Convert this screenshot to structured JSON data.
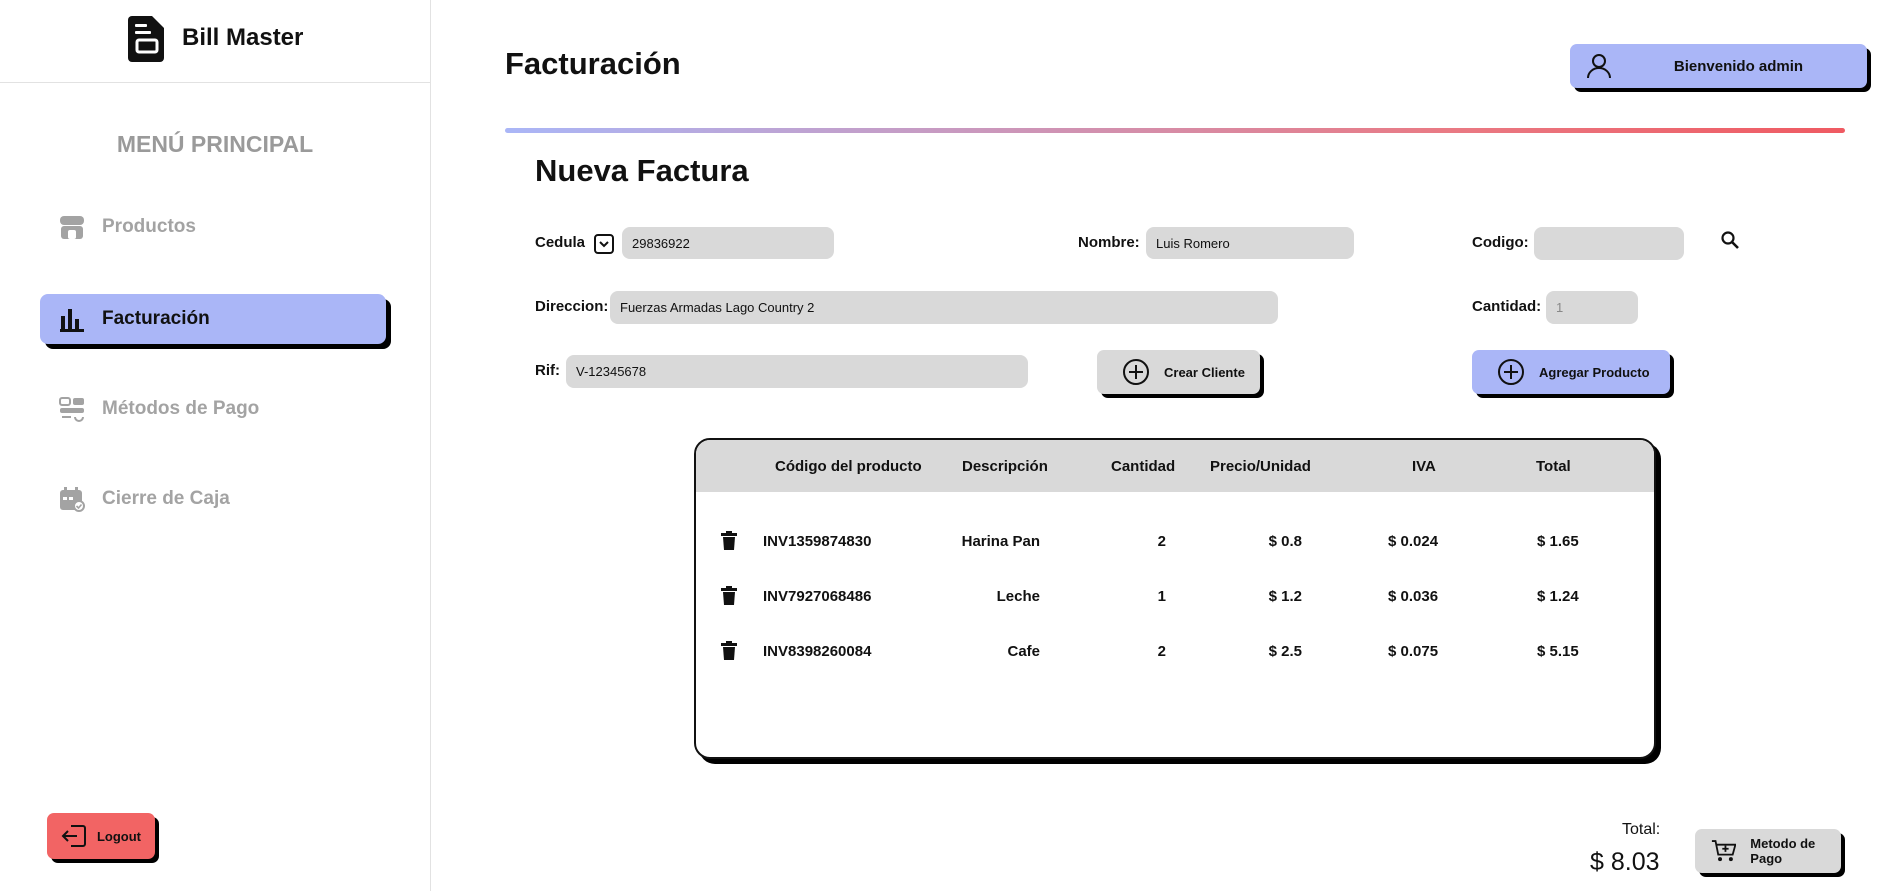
{
  "app": {
    "name": "Bill Master",
    "menu_title": "MENÚ PRINCIPAL"
  },
  "sidebar": {
    "items": [
      {
        "label": "Productos",
        "icon": "store-icon",
        "active": false
      },
      {
        "label": "Facturación",
        "icon": "bar-chart-icon",
        "active": true
      },
      {
        "label": "Métodos de Pago",
        "icon": "payment-methods-icon",
        "active": false
      },
      {
        "label": "Cierre de Caja",
        "icon": "calendar-check-icon",
        "active": false
      }
    ],
    "logout_label": "Logout"
  },
  "header": {
    "title": "Facturación",
    "welcome": "Bienvenido admin"
  },
  "form": {
    "section_title": "Nueva Factura",
    "cedula_label": "Cedula",
    "cedula_value": "29836922",
    "nombre_label": "Nombre:",
    "nombre_value": "Luis Romero",
    "codigo_label": "Codigo:",
    "codigo_value": "",
    "direccion_label": "Direccion:",
    "direccion_value": "Fuerzas Armadas Lago Country 2",
    "cantidad_label": "Cantidad:",
    "cantidad_placeholder": "1",
    "rif_label": "Rif:",
    "rif_value": "V-12345678",
    "crear_cliente_label": "Crear Cliente",
    "agregar_producto_label": "Agregar Producto"
  },
  "table": {
    "headers": [
      "Código del producto",
      "Descripción",
      "Cantidad",
      "Precio/Unidad",
      "IVA",
      "Total"
    ],
    "rows": [
      {
        "codigo": "INV1359874830",
        "descripcion": "Harina Pan",
        "cantidad": "2",
        "precio": "$ 0.8",
        "iva": "$ 0.024",
        "total": "$ 1.65"
      },
      {
        "codigo": "INV7927068486",
        "descripcion": "Leche",
        "cantidad": "1",
        "precio": "$ 1.2",
        "iva": "$ 0.036",
        "total": "$ 1.24"
      },
      {
        "codigo": "INV8398260084",
        "descripcion": "Cafe",
        "cantidad": "2",
        "precio": "$ 2.5",
        "iva": "$ 0.075",
        "total": "$ 5.15"
      }
    ]
  },
  "footer": {
    "total_label": "Total:",
    "total_value": "$ 8.03",
    "pay_label": "Metodo de Pago"
  },
  "colors": {
    "accent": "#aab6f7",
    "danger": "#f26464",
    "field": "#d9d9d9",
    "muted": "#a3a3a3"
  }
}
